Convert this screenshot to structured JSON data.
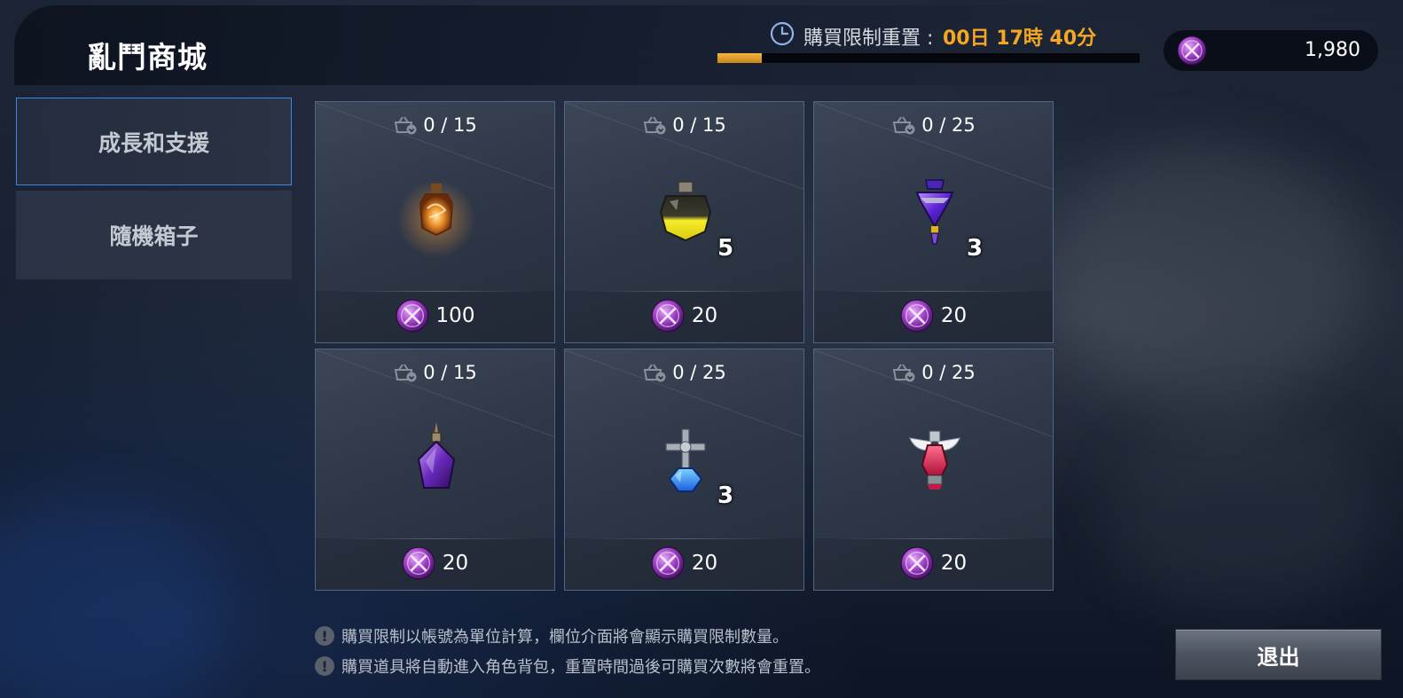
{
  "header": {
    "title": "亂鬥商城",
    "reset": {
      "label": "購買限制重置 : ",
      "value": "00日 17時 40分",
      "progress": 0.106
    },
    "currency": {
      "icon": "purple-coin-icon",
      "amount": "1,980"
    }
  },
  "sidebar": {
    "tabs": [
      {
        "label": "成長和支援",
        "active": true
      },
      {
        "label": "隨機箱子",
        "active": false
      }
    ]
  },
  "items": [
    {
      "limit": "0 / 15",
      "icon": "orange-lantern-potion-icon",
      "quantity": "",
      "price": "100"
    },
    {
      "limit": "0 / 15",
      "icon": "yellow-potion-icon",
      "quantity": "5",
      "price": "20"
    },
    {
      "limit": "0 / 25",
      "icon": "purple-diamond-potion-icon",
      "quantity": "3",
      "price": "20"
    },
    {
      "limit": "0 / 15",
      "icon": "purple-crystal-bottle-icon",
      "quantity": "",
      "price": "20"
    },
    {
      "limit": "0 / 25",
      "icon": "blue-cross-potion-icon",
      "quantity": "3",
      "price": "20"
    },
    {
      "limit": "0 / 25",
      "icon": "red-winged-potion-icon",
      "quantity": "",
      "price": "20"
    }
  ],
  "notes": [
    "購買限制以帳號為單位計算，欄位介面將會顯示購買限制數量。",
    "購買道具將自動進入角色背包，重置時間過後可購買次數將會重置。"
  ],
  "exit_label": "退出",
  "colors": {
    "accent_gold": "#f5a623",
    "tab_border": "#3d86e6",
    "coin_purple": "#8e3fb3"
  }
}
